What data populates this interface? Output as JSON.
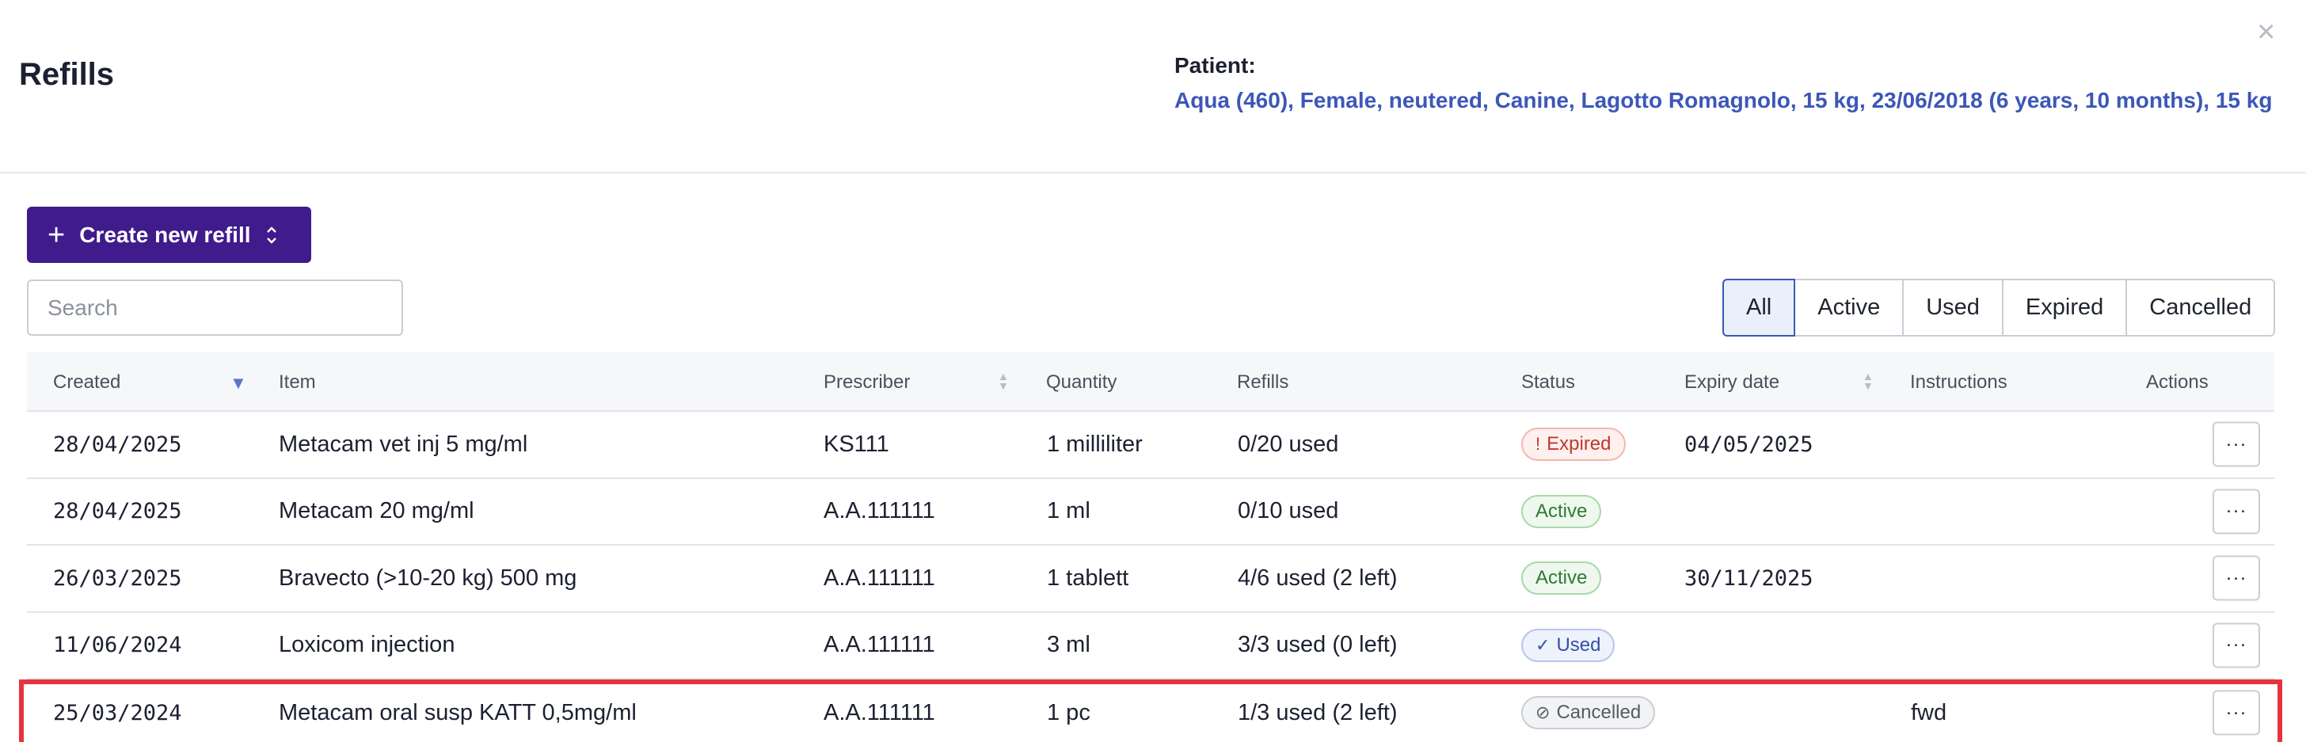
{
  "header": {
    "title": "Refills",
    "patient_label": "Patient:",
    "patient_info": "Aqua (460), Female, neutered, Canine, Lagotto Romagnolo, 15 kg, 23/06/2018 (6 years, 10 months), 15 kg",
    "close_glyph": "×"
  },
  "toolbar": {
    "create_label": "Create new refill",
    "search_placeholder": "Search"
  },
  "filters": [
    {
      "label": "All",
      "active": true
    },
    {
      "label": "Active",
      "active": false
    },
    {
      "label": "Used",
      "active": false
    },
    {
      "label": "Expired",
      "active": false
    },
    {
      "label": "Cancelled",
      "active": false
    }
  ],
  "table": {
    "columns": [
      "Created",
      "Item",
      "Prescriber",
      "Quantity",
      "Refills",
      "Status",
      "Expiry date",
      "Instructions",
      "Actions"
    ],
    "sort": {
      "column": "Created",
      "direction": "descending"
    },
    "rows": [
      {
        "created": "28/04/2025",
        "item": "Metacam vet inj 5 mg/ml",
        "prescriber": "KS111",
        "quantity": "1 milliliter",
        "refills": "0/20 used",
        "status": "Expired",
        "status_icon": "!",
        "expiry": "04/05/2025",
        "instructions": "",
        "action": "···"
      },
      {
        "created": "28/04/2025",
        "item": "Metacam 20 mg/ml",
        "prescriber": "A.A.111111",
        "quantity": "1 ml",
        "refills": "0/10 used",
        "status": "Active",
        "status_icon": "",
        "expiry": "",
        "instructions": "",
        "action": "···"
      },
      {
        "created": "26/03/2025",
        "item": "Bravecto (>10-20 kg) 500 mg",
        "prescriber": "A.A.111111",
        "quantity": "1 tablett",
        "refills": "4/6 used (2 left)",
        "status": "Active",
        "status_icon": "",
        "expiry": "30/11/2025",
        "instructions": "",
        "action": "···"
      },
      {
        "created": "11/06/2024",
        "item": "Loxicom injection",
        "prescriber": "A.A.111111",
        "quantity": "3 ml",
        "refills": "3/3 used (0 left)",
        "status": "Used",
        "status_icon": "✓",
        "expiry": "",
        "instructions": "",
        "action": "···"
      },
      {
        "created": "25/03/2024",
        "item": "Metacam oral susp KATT 0,5mg/ml",
        "prescriber": "A.A.111111",
        "quantity": "1 pc",
        "refills": "1/3 used (2 left)",
        "status": "Cancelled",
        "status_icon": "⊘",
        "expiry": "",
        "instructions": "fwd",
        "action": "···"
      }
    ]
  },
  "colors": {
    "primary": "#3f1b8c",
    "patient_link": "#3d57b8",
    "highlight_border": "#e5343f"
  }
}
